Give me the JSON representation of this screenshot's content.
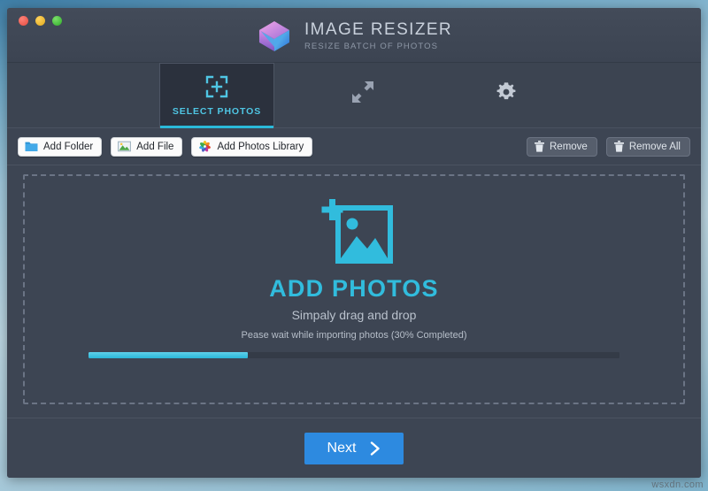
{
  "window": {
    "controls": [
      {
        "name": "close",
        "color": "#e24b40"
      },
      {
        "name": "minimize",
        "color": "#e0a91c"
      },
      {
        "name": "maximize",
        "color": "#2eab29"
      }
    ]
  },
  "header": {
    "title": "IMAGE RESIZER",
    "subtitle": "RESIZE BATCH OF PHOTOS",
    "logo_icon": "image-stack-icon"
  },
  "tabs": [
    {
      "label": "SELECT PHOTOS",
      "icon": "crosshair-plus-icon",
      "active": true
    },
    {
      "label": "",
      "icon": "resize-arrows-icon",
      "active": false
    },
    {
      "label": "",
      "icon": "gear-icon",
      "active": false
    }
  ],
  "toolbar": {
    "left": [
      {
        "label": "Add Folder",
        "icon": "folder-icon"
      },
      {
        "label": "Add File",
        "icon": "picture-icon"
      },
      {
        "label": "Add Photos Library",
        "icon": "photos-library-icon"
      }
    ],
    "right": [
      {
        "label": "Remove",
        "icon": "trash-icon"
      },
      {
        "label": "Remove All",
        "icon": "trash-icon"
      }
    ]
  },
  "dropzone": {
    "icon": "add-photo-icon",
    "title": "ADD PHOTOS",
    "subtitle": "Simpaly drag and drop",
    "progress_label": "Pease wait while importing photos (30% Completed)",
    "progress_percent": 30
  },
  "footer": {
    "next_label": "Next",
    "next_icon": "chevron-right-icon"
  },
  "watermark": "wsxdn.com",
  "colors": {
    "accent_cyan": "#31bcdd",
    "accent_blue": "#2d8ae0",
    "window_bg": "#3d4553",
    "tab_active_bg": "#2b313d"
  }
}
